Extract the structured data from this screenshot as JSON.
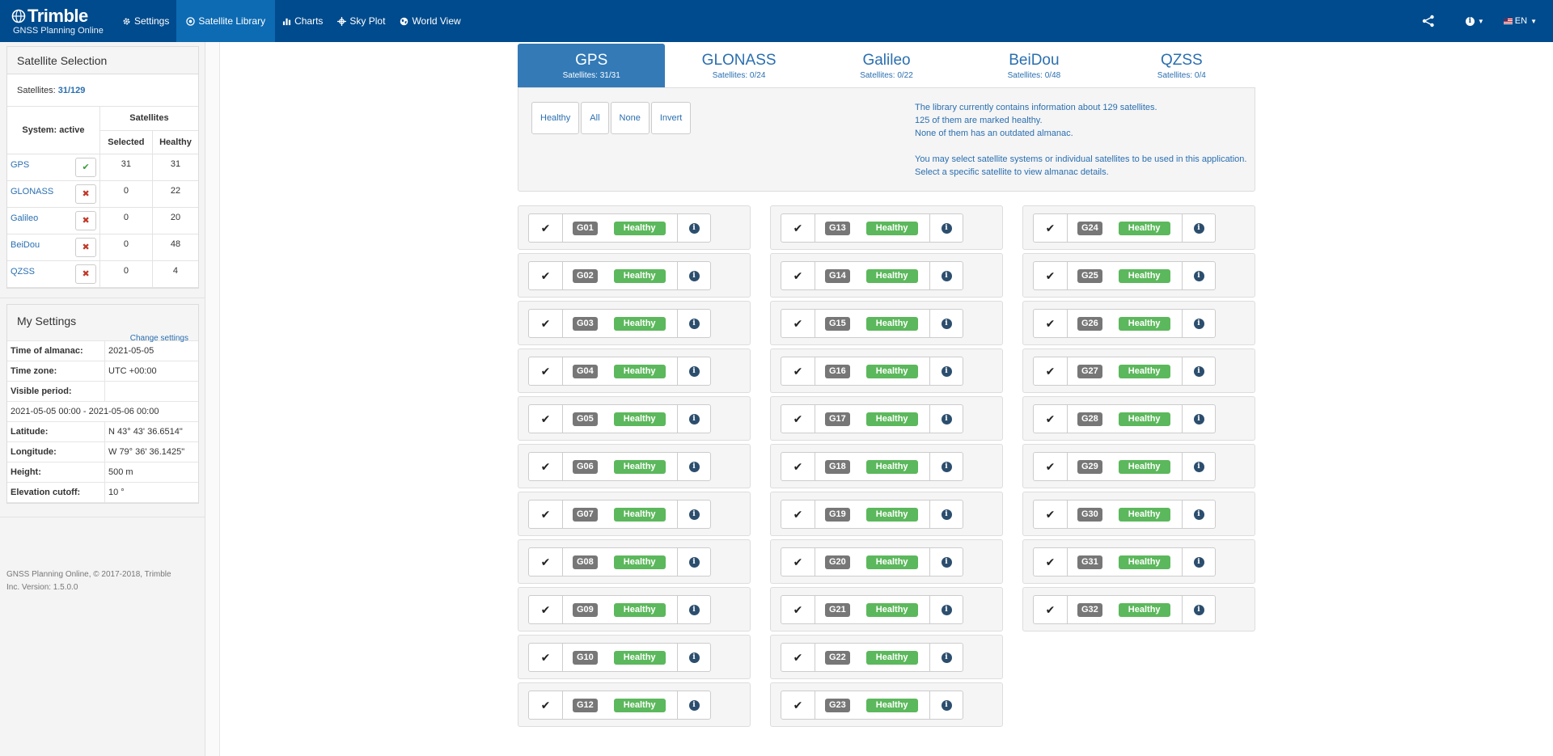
{
  "brand": {
    "name": "Trimble",
    "subtitle": "GNSS Planning Online"
  },
  "nav": [
    {
      "label": "Settings",
      "icon": "gear-icon",
      "active": false
    },
    {
      "label": "Satellite Library",
      "icon": "target-icon",
      "active": true
    },
    {
      "label": "Charts",
      "icon": "bar-chart-icon",
      "active": false
    },
    {
      "label": "Sky Plot",
      "icon": "crosshair-icon",
      "active": false
    },
    {
      "label": "World View",
      "icon": "globe-icon",
      "active": false
    }
  ],
  "nav_right": {
    "lang": "EN"
  },
  "selection": {
    "title": "Satellite Selection",
    "count_label": "Satellites:",
    "count_value": "31/129",
    "header_system": "System: active",
    "header_satellites": "Satellites",
    "header_selected": "Selected",
    "header_healthy": "Healthy",
    "systems": [
      {
        "name": "GPS",
        "active": true,
        "selected": "31",
        "healthy": "31"
      },
      {
        "name": "GLONASS",
        "active": false,
        "selected": "0",
        "healthy": "22"
      },
      {
        "name": "Galileo",
        "active": false,
        "selected": "0",
        "healthy": "20"
      },
      {
        "name": "BeiDou",
        "active": false,
        "selected": "0",
        "healthy": "48"
      },
      {
        "name": "QZSS",
        "active": false,
        "selected": "0",
        "healthy": "4"
      }
    ]
  },
  "settings": {
    "title": "My Settings",
    "change_link": "Change settings",
    "rows": [
      {
        "k": "Time of almanac:",
        "v": "2021-05-05"
      },
      {
        "k": "Time zone:",
        "v": "UTC +00:00"
      },
      {
        "k": "Visible period:",
        "v": ""
      },
      {
        "k": "2021-05-05 00:00 - 2021-05-06 00:00",
        "v": null
      },
      {
        "k": "Latitude:",
        "v": "N 43° 43' 36.6514\""
      },
      {
        "k": "Longitude:",
        "v": "W 79° 36' 36.1425\""
      },
      {
        "k": "Height:",
        "v": "500 m"
      },
      {
        "k": "Elevation cutoff:",
        "v": "10 °"
      }
    ]
  },
  "footer": {
    "line1": "GNSS Planning Online, © 2017-2018, Trimble",
    "line2": "Inc. Version: 1.5.0.0"
  },
  "tabs": [
    {
      "name": "GPS",
      "sub": "Satellites: 31/31",
      "active": true
    },
    {
      "name": "GLONASS",
      "sub": "Satellites: 0/24",
      "active": false
    },
    {
      "name": "Galileo",
      "sub": "Satellites: 0/22",
      "active": false
    },
    {
      "name": "BeiDou",
      "sub": "Satellites: 0/48",
      "active": false
    },
    {
      "name": "QZSS",
      "sub": "Satellites: 0/4",
      "active": false
    }
  ],
  "filters": [
    "Healthy",
    "All",
    "None",
    "Invert"
  ],
  "info_lines": [
    "The library currently contains information about 129 satellites.",
    "125 of them are marked healthy.",
    "None of them has an outdated almanac.",
    "",
    "You may select satellite systems or individual satellites to be used in this application.",
    "Select a specific satellite to view almanac details."
  ],
  "satellite_columns": [
    [
      {
        "id": "G01",
        "status": "Healthy"
      },
      {
        "id": "G02",
        "status": "Healthy"
      },
      {
        "id": "G03",
        "status": "Healthy"
      },
      {
        "id": "G04",
        "status": "Healthy"
      },
      {
        "id": "G05",
        "status": "Healthy"
      },
      {
        "id": "G06",
        "status": "Healthy"
      },
      {
        "id": "G07",
        "status": "Healthy"
      },
      {
        "id": "G08",
        "status": "Healthy"
      },
      {
        "id": "G09",
        "status": "Healthy"
      },
      {
        "id": "G10",
        "status": "Healthy"
      },
      {
        "id": "G12",
        "status": "Healthy"
      }
    ],
    [
      {
        "id": "G13",
        "status": "Healthy"
      },
      {
        "id": "G14",
        "status": "Healthy"
      },
      {
        "id": "G15",
        "status": "Healthy"
      },
      {
        "id": "G16",
        "status": "Healthy"
      },
      {
        "id": "G17",
        "status": "Healthy"
      },
      {
        "id": "G18",
        "status": "Healthy"
      },
      {
        "id": "G19",
        "status": "Healthy"
      },
      {
        "id": "G20",
        "status": "Healthy"
      },
      {
        "id": "G21",
        "status": "Healthy"
      },
      {
        "id": "G22",
        "status": "Healthy"
      },
      {
        "id": "G23",
        "status": "Healthy"
      }
    ],
    [
      {
        "id": "G24",
        "status": "Healthy"
      },
      {
        "id": "G25",
        "status": "Healthy"
      },
      {
        "id": "G26",
        "status": "Healthy"
      },
      {
        "id": "G27",
        "status": "Healthy"
      },
      {
        "id": "G28",
        "status": "Healthy"
      },
      {
        "id": "G29",
        "status": "Healthy"
      },
      {
        "id": "G30",
        "status": "Healthy"
      },
      {
        "id": "G31",
        "status": "Healthy"
      },
      {
        "id": "G32",
        "status": "Healthy"
      }
    ]
  ],
  "colors": {
    "navbar": "#004b8d",
    "nav_active": "#0d6bb3",
    "tab_active": "#337ab7",
    "link": "#2a6fb0",
    "healthy": "#5cb85c",
    "id_label": "#777777"
  }
}
